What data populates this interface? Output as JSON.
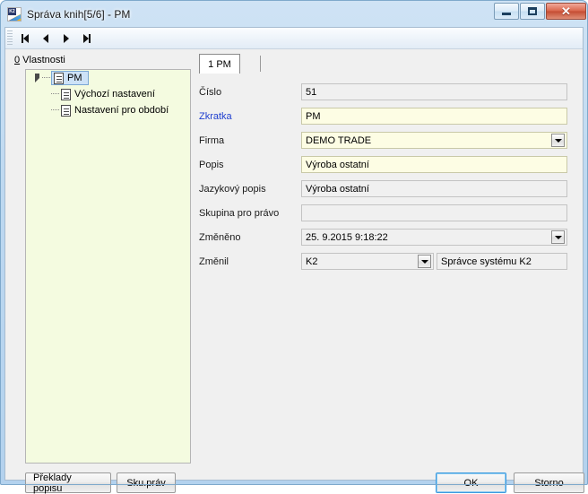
{
  "window": {
    "title": "Správa knih[5/6] - PM",
    "app_icon": "k2-app-icon",
    "controls": {
      "minimize": "Minimalizovat",
      "maximize": "Maximalizovat",
      "close": "✕"
    }
  },
  "toolbar": {
    "buttons": [
      {
        "name": "first-record",
        "icon": "first-record-icon"
      },
      {
        "name": "previous-record",
        "icon": "previous-record-icon"
      },
      {
        "name": "next-record",
        "icon": "next-record-icon"
      },
      {
        "name": "last-record",
        "icon": "last-record-icon"
      }
    ]
  },
  "tree_panel": {
    "label_accel": "0",
    "label_text": " Vlastnosti",
    "nodes": [
      {
        "label": "PM",
        "icon": "document-icon",
        "selected": true,
        "expanded": true
      },
      {
        "label": "Výchozí nastavení",
        "icon": "document-icon",
        "selected": false
      },
      {
        "label": "Nastavení pro období",
        "icon": "documents-stack-icon",
        "selected": false
      }
    ]
  },
  "tabs": [
    {
      "label": "1 PM",
      "active": true
    }
  ],
  "form": {
    "fields": [
      {
        "label": "Číslo",
        "value": "51",
        "editable": false,
        "dropdown": false
      },
      {
        "label": "Zkratka",
        "value": "PM",
        "editable": true,
        "dropdown": false,
        "required": true
      },
      {
        "label": "Firma",
        "value": "DEMO TRADE",
        "editable": true,
        "dropdown": true
      },
      {
        "label": "Popis",
        "value": "Výroba ostatní",
        "editable": true,
        "dropdown": false
      },
      {
        "label": "Jazykový popis",
        "value": "Výroba ostatní",
        "editable": false,
        "dropdown": false
      },
      {
        "label": "Skupina pro právo",
        "value": "",
        "editable": false,
        "dropdown": false
      },
      {
        "label": "Změněno",
        "value": "25. 9.2015  9:18:22",
        "editable": false,
        "dropdown": true
      },
      {
        "label": "Změnil",
        "value": "K2",
        "value2": "Správce systému K2",
        "editable": false,
        "dropdown": true
      }
    ]
  },
  "buttons": {
    "translate": "Překlady popisu",
    "rights_group": "Sku.práv",
    "ok": "OK",
    "cancel": "Storno"
  },
  "colors": {
    "required_label": "#1f3fcf",
    "editable_field": "#fdfde4",
    "readonly_field": "#f0f0f0",
    "tree_background": "#f4fbe0",
    "selection": "#cde2f7",
    "focus_ring": "#3c9adf"
  }
}
